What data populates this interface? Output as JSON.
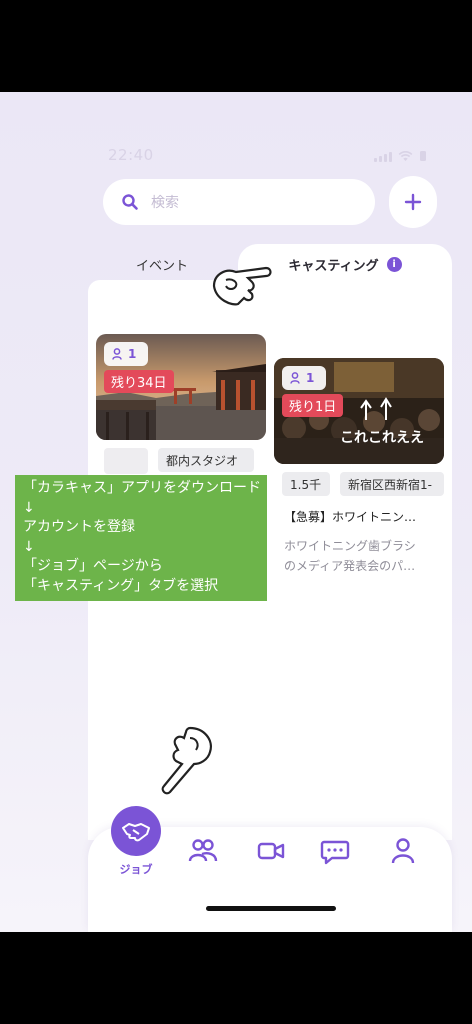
{
  "status_bar": {
    "time": "22:40"
  },
  "search": {
    "placeholder": "検索"
  },
  "tabs": {
    "event": "イベント",
    "casting": "キャスティング"
  },
  "cards": [
    {
      "people_count": "1",
      "remaining": "残り34日",
      "tags": [
        "都内スタジオ"
      ]
    },
    {
      "people_count": "1",
      "remaining": "残り1日",
      "image_overlay_text": "これこれええ",
      "tags": [
        "1.5千",
        "新宿区西新宿1-"
      ],
      "title": "【急募】ホワイトニン…",
      "description": [
        "ホワイトニング歯ブラシ",
        "のメディア発表会のパ…"
      ]
    }
  ],
  "annotation": {
    "lines": [
      "「カラキャス」アプリをダウンロード",
      "↓",
      "アカウントを登録",
      "↓",
      "「ジョブ」ページから",
      "「キャスティング」タブを選択"
    ]
  },
  "bottom_nav": {
    "items": [
      {
        "label": "ジョブ",
        "icon": "handshake-icon",
        "active": true
      },
      {
        "icon": "people-icon"
      },
      {
        "icon": "video-icon"
      },
      {
        "icon": "chat-icon"
      },
      {
        "icon": "profile-icon"
      }
    ]
  },
  "colors": {
    "accent": "#7b54d6",
    "badge_red": "#e34a5a",
    "annotation_green": "#6db44a"
  }
}
